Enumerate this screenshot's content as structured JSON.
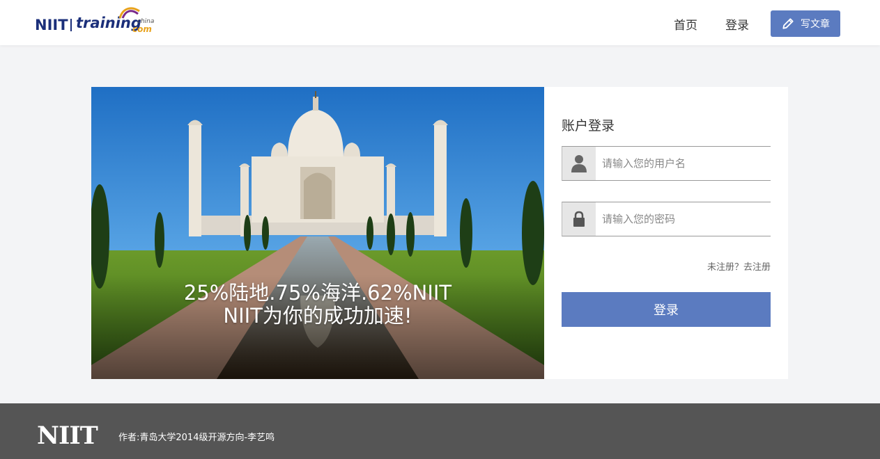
{
  "header": {
    "logo": {
      "brand": "NIIT",
      "training": "training",
      "china": "china",
      "com": "com"
    },
    "nav": {
      "home_label": "首页",
      "login_label": "登录"
    },
    "write_button": {
      "label": "写文章",
      "icon": "pencil-icon"
    }
  },
  "hero": {
    "caption_line1": "25%陆地.75%海洋.62%NIIT",
    "caption_line2": "NIIT为你的成功加速!"
  },
  "login": {
    "title": "账户登录",
    "username": {
      "placeholder": "请输入您的用户名",
      "value": "",
      "icon": "user-icon"
    },
    "password": {
      "placeholder": "请输入您的密码",
      "value": "",
      "icon": "lock-icon"
    },
    "register_link": "未注册？去注册",
    "submit_label": "登录"
  },
  "footer": {
    "logo": "NIIT",
    "author_text": "作者:青岛大学2014级开源方向-李艺鸣"
  },
  "colors": {
    "accent": "#5b7bc0",
    "footer_bg": "#555555",
    "page_bg": "#f3f4f6"
  }
}
